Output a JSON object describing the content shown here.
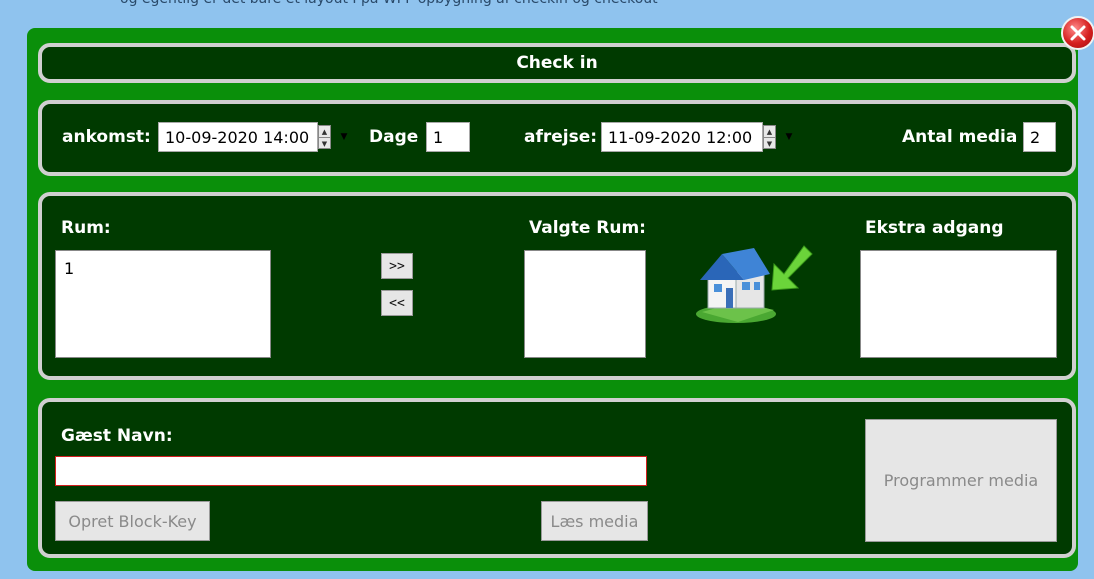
{
  "caption": "og egentlig er det bare et layout I på WPF opbygning af checkin og checkout",
  "title": "Check in",
  "dates": {
    "arrival_label": "ankomst:",
    "arrival_value": "10-09-2020 14:00",
    "days_label": "Dage",
    "days_value": "1",
    "departure_label": "afrejse:",
    "departure_value": "11-09-2020 12:00",
    "media_count_label": "Antal media",
    "media_count_value": "2"
  },
  "rooms": {
    "rooms_label": "Rum:",
    "rooms_items": [
      "1"
    ],
    "add_button": ">>",
    "remove_button": "<<",
    "selected_label": "Valgte Rum:",
    "extra_label": "Ekstra adgang"
  },
  "guest": {
    "name_label": "Gæst Navn:",
    "name_value": "",
    "block_key_button": "Opret Block-Key",
    "read_media_button": "Læs media",
    "program_media_button": "Programmer media"
  },
  "icons": {
    "close": "close-icon",
    "house": "house-checkin-icon"
  }
}
